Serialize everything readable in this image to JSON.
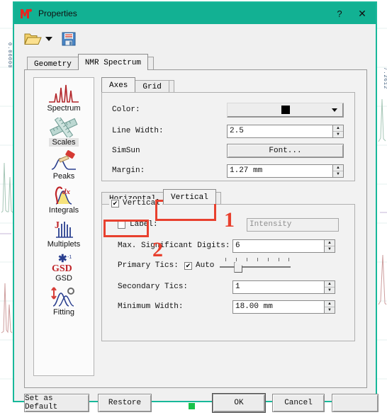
{
  "window": {
    "title": "Properties",
    "logo_icon": "mnova-m-logo",
    "help_icon": "?",
    "close_icon": "✕"
  },
  "toolbar": {
    "open_icon": "open-folder-icon",
    "open_dropdown_icon": "chevron-down-icon",
    "save_icon": "save-floppy-icon"
  },
  "outer_tabs": [
    {
      "label": "Geometry",
      "active": false
    },
    {
      "label": "NMR Spectrum",
      "active": true
    }
  ],
  "sidebar": {
    "items": [
      {
        "label": "Spectrum",
        "icon": "spectrum-icon",
        "selected": false
      },
      {
        "label": "Scales",
        "icon": "ruler-icon",
        "selected": true
      },
      {
        "label": "Peaks",
        "icon": "peak-pick-icon",
        "selected": false
      },
      {
        "label": "Integrals",
        "icon": "integral-icon",
        "selected": false
      },
      {
        "label": "Multiplets",
        "icon": "multiplet-icon",
        "selected": false
      },
      {
        "label": "GSD",
        "icon": "gsd-icon",
        "selected": false
      },
      {
        "label": "Fitting",
        "icon": "fitting-icon",
        "selected": false
      }
    ]
  },
  "inner_tabs": [
    {
      "label": "Axes",
      "active": true
    },
    {
      "label": "Grid",
      "active": false
    }
  ],
  "axes_group": {
    "color": {
      "label": "Color:",
      "value_hex": "#000000"
    },
    "line_width": {
      "label": "Line Width:",
      "value": "2.5"
    },
    "font": {
      "name": "SimSun",
      "button_label": "Font..."
    },
    "margin": {
      "label": "Margin:",
      "value": "1.27 mm"
    }
  },
  "orientation_tabs": [
    {
      "label": "Horizontal",
      "active": false
    },
    {
      "label": "Vertical",
      "active": true
    }
  ],
  "vertical_group": {
    "enabled_checkbox": {
      "label": "Vertical",
      "checked": true
    },
    "label_checkbox": {
      "label": "Label:",
      "checked": false
    },
    "label_value": "Intensity",
    "max_significant_digits": {
      "label": "Max. Significant Digits:",
      "value": "6"
    },
    "primary_tics": {
      "label": "Primary Tics:",
      "auto_label": "Auto",
      "auto_checked": true,
      "slider_percent": 20
    },
    "secondary_tics": {
      "label": "Secondary Tics:",
      "value": "1"
    },
    "minimum_width": {
      "label": "Minimum Width:",
      "value": "18.00 mm"
    }
  },
  "footer": {
    "set_as_default": "Set as Default",
    "restore": "Restore",
    "ok": "OK",
    "cancel": "Cancel"
  },
  "annotations": [
    {
      "number": "1",
      "target": "vertical-tab"
    },
    {
      "number": "2",
      "target": "label-checkbox"
    }
  ],
  "background": {
    "left_axis_text": "0.00000",
    "right_axis_text": "7.2612"
  },
  "colors": {
    "titlebar": "#12b193",
    "window_border": "#18b89a",
    "annotation": "#e8402e",
    "dialog_face": "#f0f0f0"
  }
}
